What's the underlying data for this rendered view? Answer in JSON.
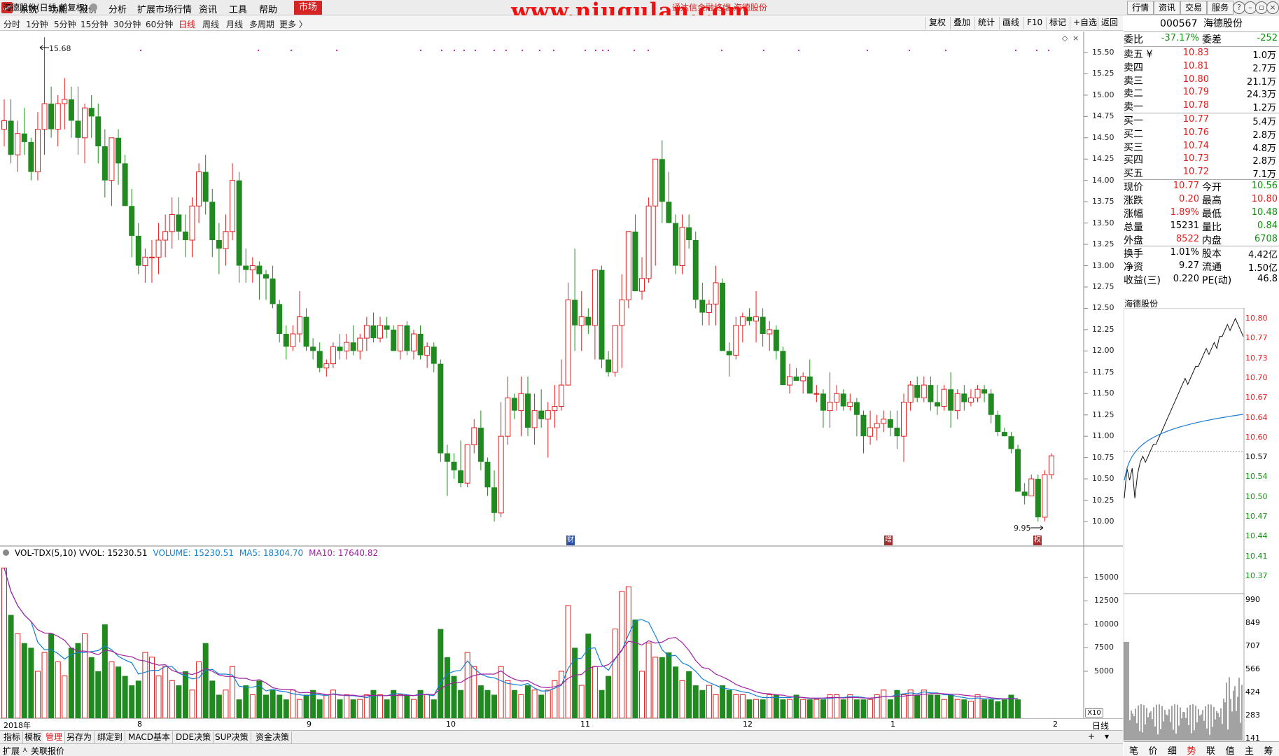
{
  "menu": {
    "items": [
      "系统",
      "功能",
      "报价",
      "分析",
      "扩展市场行情",
      "资讯",
      "工具",
      "帮助"
    ],
    "market": "市场",
    "window_title": "通达信金融终端  海德股份",
    "watermark": "www.niugulan.com",
    "right_tabs": [
      "行情",
      "资讯",
      "交易",
      "服务"
    ]
  },
  "periods": {
    "items": [
      "分时",
      "1分钟",
      "5分钟",
      "15分钟",
      "30分钟",
      "60分钟",
      "日线",
      "周线",
      "月线",
      "多周期",
      "更多 〉"
    ],
    "active": "日线"
  },
  "toolbar": {
    "items": [
      "复权",
      "叠加",
      "统计",
      "画线",
      "F10",
      "标记",
      "+自选",
      "返回"
    ]
  },
  "chart": {
    "title": "海德股份(日线,前复权)",
    "max_label": "15.68",
    "min_label": "9.95",
    "markers": [
      "财",
      "增",
      "权"
    ],
    "dates": [
      "2018年",
      "8",
      "9",
      "10",
      "11",
      "12",
      "1",
      "2"
    ],
    "period_label": "日线",
    "zoom_btn": "X10",
    "price_ticks": [
      "15.50",
      "15.25",
      "15.00",
      "14.75",
      "14.50",
      "14.25",
      "14.00",
      "13.75",
      "13.50",
      "13.25",
      "13.00",
      "12.75",
      "12.50",
      "12.25",
      "12.00",
      "11.75",
      "11.50",
      "11.25",
      "11.00",
      "10.75",
      "10.50",
      "10.25",
      "10.00"
    ],
    "vol_ticks": [
      "15000",
      "12500",
      "10000",
      "7500",
      "5000"
    ]
  },
  "chart_data": {
    "type": "candlestick",
    "title": "海德股份(日线,前复权)",
    "ylim": [
      9.9,
      15.8
    ],
    "ohlc": [
      [
        14.6,
        14.95,
        14.4,
        14.7
      ],
      [
        14.7,
        14.95,
        14.2,
        14.3
      ],
      [
        14.3,
        14.7,
        14.1,
        14.55
      ],
      [
        14.55,
        14.85,
        14.3,
        14.45
      ],
      [
        14.45,
        14.5,
        14.0,
        14.1
      ],
      [
        14.1,
        14.8,
        14.0,
        14.6
      ],
      [
        14.6,
        15.68,
        14.3,
        14.9
      ],
      [
        14.9,
        15.1,
        14.5,
        14.6
      ],
      [
        14.6,
        15.0,
        14.4,
        14.9
      ],
      [
        14.9,
        15.2,
        14.6,
        14.95
      ],
      [
        14.95,
        15.1,
        14.5,
        14.7
      ],
      [
        14.7,
        15.1,
        14.3,
        14.5
      ],
      [
        14.5,
        14.9,
        14.2,
        14.85
      ],
      [
        14.85,
        15.0,
        14.5,
        14.75
      ],
      [
        14.75,
        14.9,
        14.2,
        14.4
      ],
      [
        14.4,
        14.6,
        13.8,
        14.0
      ],
      [
        14.0,
        14.5,
        13.7,
        14.5
      ],
      [
        14.5,
        14.6,
        13.95,
        14.2
      ],
      [
        14.2,
        14.3,
        13.7,
        13.7
      ],
      [
        13.7,
        13.9,
        13.1,
        13.35
      ],
      [
        13.35,
        13.5,
        12.9,
        13.0
      ],
      [
        13.0,
        13.2,
        12.8,
        13.1
      ],
      [
        13.1,
        13.3,
        12.8,
        13.1
      ],
      [
        13.1,
        13.5,
        12.9,
        13.3
      ],
      [
        13.3,
        13.6,
        13.1,
        13.4
      ],
      [
        13.4,
        13.8,
        13.2,
        13.6
      ],
      [
        13.6,
        13.8,
        13.3,
        13.4
      ],
      [
        13.4,
        13.6,
        13.1,
        13.3
      ],
      [
        13.3,
        13.8,
        13.1,
        13.7
      ],
      [
        13.7,
        14.2,
        13.5,
        14.1
      ],
      [
        14.1,
        14.3,
        13.6,
        13.75
      ],
      [
        13.75,
        13.9,
        13.1,
        13.3
      ],
      [
        13.3,
        13.5,
        12.9,
        13.2
      ],
      [
        13.2,
        13.6,
        13.0,
        13.4
      ],
      [
        13.4,
        14.2,
        13.3,
        14.0
      ],
      [
        14.0,
        14.1,
        12.8,
        13.0
      ],
      [
        13.0,
        13.2,
        12.8,
        12.95
      ],
      [
        12.95,
        13.1,
        12.8,
        13.0
      ],
      [
        13.0,
        13.05,
        12.6,
        12.9
      ],
      [
        12.9,
        12.95,
        12.6,
        12.85
      ],
      [
        12.85,
        13.0,
        12.5,
        12.55
      ],
      [
        12.55,
        12.6,
        12.1,
        12.2
      ],
      [
        12.2,
        12.3,
        11.9,
        12.05
      ],
      [
        12.05,
        12.3,
        12.0,
        12.2
      ],
      [
        12.2,
        12.7,
        12.1,
        12.4
      ],
      [
        12.4,
        12.5,
        12.0,
        12.05
      ],
      [
        12.05,
        12.15,
        11.9,
        12.0
      ],
      [
        12.0,
        12.1,
        11.75,
        11.8
      ],
      [
        11.8,
        11.9,
        11.7,
        11.85
      ],
      [
        11.85,
        12.1,
        11.8,
        12.05
      ],
      [
        12.05,
        12.2,
        11.9,
        12.0
      ],
      [
        12.0,
        12.2,
        11.9,
        12.1
      ],
      [
        12.1,
        12.3,
        11.95,
        12.0
      ],
      [
        12.0,
        12.2,
        11.9,
        12.15
      ],
      [
        12.15,
        12.4,
        12.0,
        12.3
      ],
      [
        12.3,
        12.45,
        12.1,
        12.15
      ],
      [
        12.15,
        12.4,
        12.1,
        12.3
      ],
      [
        12.3,
        12.4,
        12.15,
        12.25
      ],
      [
        12.25,
        12.3,
        12.0,
        12.0
      ],
      [
        12.0,
        12.3,
        11.9,
        12.3
      ],
      [
        12.3,
        12.35,
        11.95,
        12.0
      ],
      [
        12.0,
        12.25,
        11.9,
        12.2
      ],
      [
        12.2,
        12.3,
        11.9,
        11.95
      ],
      [
        11.95,
        12.1,
        11.8,
        12.05
      ],
      [
        12.05,
        12.1,
        11.75,
        11.85
      ],
      [
        11.85,
        11.9,
        10.7,
        10.8
      ],
      [
        10.8,
        10.9,
        10.3,
        10.7
      ],
      [
        10.7,
        10.8,
        10.5,
        10.6
      ],
      [
        10.6,
        10.95,
        10.4,
        10.45
      ],
      [
        10.45,
        10.9,
        10.4,
        10.9
      ],
      [
        10.9,
        11.2,
        10.8,
        11.1
      ],
      [
        11.1,
        11.3,
        10.6,
        10.7
      ],
      [
        10.7,
        10.75,
        10.3,
        10.4
      ],
      [
        10.4,
        10.6,
        10.0,
        10.1
      ],
      [
        10.1,
        11.4,
        10.05,
        11.0
      ],
      [
        11.0,
        11.7,
        10.9,
        11.45
      ],
      [
        11.45,
        11.5,
        11.2,
        11.3
      ],
      [
        11.3,
        11.7,
        11.0,
        11.5
      ],
      [
        11.5,
        11.7,
        11.0,
        11.1
      ],
      [
        11.1,
        11.5,
        10.9,
        11.3
      ],
      [
        11.3,
        11.55,
        11.1,
        11.2
      ],
      [
        11.2,
        11.4,
        10.75,
        11.3
      ],
      [
        11.3,
        11.6,
        11.1,
        11.35
      ],
      [
        11.35,
        11.9,
        11.3,
        11.6
      ],
      [
        11.6,
        12.8,
        11.6,
        12.6
      ],
      [
        12.6,
        13.2,
        12.0,
        12.3
      ],
      [
        12.3,
        12.7,
        12.0,
        12.4
      ],
      [
        12.4,
        12.5,
        12.2,
        12.3
      ],
      [
        12.3,
        12.9,
        11.9,
        12.95
      ],
      [
        12.95,
        13.0,
        11.8,
        11.9
      ],
      [
        11.9,
        12.0,
        11.7,
        11.75
      ],
      [
        11.75,
        12.3,
        11.7,
        12.3
      ],
      [
        12.3,
        12.9,
        11.8,
        12.6
      ],
      [
        12.6,
        13.4,
        12.5,
        13.4
      ],
      [
        13.4,
        13.6,
        12.7,
        12.7
      ],
      [
        12.7,
        13.1,
        12.6,
        12.85
      ],
      [
        12.85,
        13.8,
        12.8,
        13.7
      ],
      [
        13.7,
        14.2,
        13.0,
        14.25
      ],
      [
        14.25,
        14.47,
        13.5,
        13.75
      ],
      [
        13.75,
        14.1,
        13.5,
        13.5
      ],
      [
        13.5,
        13.6,
        12.9,
        13.0
      ],
      [
        13.0,
        13.6,
        12.9,
        13.45
      ],
      [
        13.45,
        13.6,
        13.2,
        13.3
      ],
      [
        13.3,
        13.4,
        12.5,
        12.6
      ],
      [
        12.6,
        12.8,
        12.3,
        12.45
      ],
      [
        12.45,
        12.6,
        12.3,
        12.55
      ],
      [
        12.55,
        13.0,
        12.3,
        12.8
      ],
      [
        12.8,
        12.85,
        12.0,
        12.0
      ],
      [
        12.0,
        12.1,
        11.7,
        11.95
      ],
      [
        11.95,
        12.4,
        11.9,
        12.3
      ],
      [
        12.3,
        12.45,
        12.1,
        12.4
      ],
      [
        12.4,
        12.5,
        12.3,
        12.35
      ],
      [
        12.35,
        12.7,
        12.1,
        12.4
      ],
      [
        12.4,
        12.5,
        12.05,
        12.2
      ],
      [
        12.2,
        12.35,
        12.0,
        12.25
      ],
      [
        12.25,
        12.3,
        11.9,
        12.0
      ],
      [
        12.0,
        12.05,
        11.6,
        11.6
      ],
      [
        11.6,
        11.85,
        11.5,
        11.7
      ],
      [
        11.7,
        11.8,
        11.65,
        11.65
      ],
      [
        11.65,
        11.75,
        11.5,
        11.7
      ],
      [
        11.7,
        11.9,
        11.5,
        11.5
      ],
      [
        11.5,
        11.6,
        11.4,
        11.5
      ],
      [
        11.5,
        11.55,
        11.1,
        11.3
      ],
      [
        11.3,
        11.75,
        11.1,
        11.4
      ],
      [
        11.4,
        11.6,
        11.3,
        11.5
      ],
      [
        11.5,
        11.55,
        11.3,
        11.35
      ],
      [
        11.35,
        11.5,
        11.3,
        11.4
      ],
      [
        11.4,
        11.45,
        11.0,
        11.25
      ],
      [
        11.25,
        11.3,
        10.8,
        11.0
      ],
      [
        11.0,
        11.3,
        10.9,
        11.1
      ],
      [
        11.1,
        11.25,
        10.95,
        11.15
      ],
      [
        11.15,
        11.3,
        11.05,
        11.2
      ],
      [
        11.2,
        11.3,
        11.0,
        11.1
      ],
      [
        11.1,
        11.3,
        10.85,
        11.0
      ],
      [
        11.0,
        11.5,
        10.7,
        11.4
      ],
      [
        11.4,
        11.65,
        11.3,
        11.6
      ],
      [
        11.6,
        11.7,
        11.4,
        11.45
      ],
      [
        11.45,
        11.7,
        11.4,
        11.6
      ],
      [
        11.6,
        11.7,
        11.3,
        11.4
      ],
      [
        11.4,
        11.6,
        11.25,
        11.35
      ],
      [
        11.35,
        11.6,
        11.3,
        11.55
      ],
      [
        11.55,
        11.75,
        11.1,
        11.3
      ],
      [
        11.3,
        11.55,
        11.2,
        11.5
      ],
      [
        11.5,
        11.6,
        11.3,
        11.4
      ],
      [
        11.4,
        11.55,
        11.35,
        11.45
      ],
      [
        11.45,
        11.6,
        11.4,
        11.55
      ],
      [
        11.55,
        11.6,
        11.4,
        11.5
      ],
      [
        11.5,
        11.55,
        11.15,
        11.25
      ],
      [
        11.25,
        11.3,
        11.0,
        11.05
      ],
      [
        11.05,
        11.1,
        11.0,
        11.0
      ],
      [
        11.0,
        11.05,
        10.8,
        10.85
      ],
      [
        10.85,
        10.9,
        10.4,
        10.35
      ],
      [
        10.35,
        10.45,
        10.2,
        10.3
      ],
      [
        10.3,
        10.55,
        10.3,
        10.5
      ],
      [
        10.5,
        10.55,
        10.0,
        10.05
      ],
      [
        10.05,
        10.6,
        10.0,
        10.55
      ],
      [
        10.55,
        10.8,
        10.5,
        10.77
      ]
    ],
    "volume": {
      "title": "VOL-TDX(5,10)",
      "vvol_label": "VVOL: 15230.51",
      "volume_label": "VOLUME: 15230.51",
      "ma5_label": "MA5: 18304.70",
      "ma10_label": "MA10: 17640.82",
      "ylim": [
        0,
        17000
      ],
      "values": [
        16000,
        11000,
        9000,
        8000,
        7500,
        5000,
        7000,
        9000,
        6000,
        4500,
        7500,
        8000,
        9000,
        6500,
        5000,
        10000,
        6000,
        5500,
        4500,
        3500,
        4000,
        7000,
        6500,
        4500,
        5500,
        4000,
        3500,
        5000,
        3000,
        6000,
        8000,
        4000,
        2500,
        3000,
        5500,
        2000,
        3500,
        2500,
        4000,
        2500,
        3000,
        2500,
        2000,
        3000,
        2000,
        2500,
        3000,
        2000,
        2500,
        3000,
        2000,
        2500,
        2000,
        2000,
        2500,
        3000,
        2500,
        2000,
        3000,
        2500,
        2500,
        2000,
        3000,
        2500,
        2000,
        9500,
        6500,
        4500,
        3000,
        7000,
        5500,
        3500,
        3000,
        2500,
        5500,
        4000,
        3000,
        2500,
        3500,
        3000,
        2500,
        3000,
        4000,
        5000,
        12000,
        7500,
        3500,
        9000,
        5500,
        3000,
        4500,
        9500,
        13500,
        14000,
        10500,
        5000,
        8000,
        6500,
        6500,
        7000,
        5500,
        4000,
        5000,
        3500,
        3000,
        3500,
        2500,
        3500,
        3000,
        2500,
        2500,
        2000,
        2000,
        2000,
        2500,
        2500,
        2000,
        2000,
        2500,
        2000,
        2000,
        2000,
        2000,
        2500,
        2500,
        2000,
        2500,
        2000,
        2000,
        2000,
        2500,
        3000,
        2000,
        3000,
        2500,
        3000,
        2500,
        3000,
        2500,
        2500,
        2000,
        2500,
        2000,
        2000,
        1800,
        2500,
        2000,
        2000,
        1800,
        2000,
        2500,
        2000
      ],
      "ma5_color": "#1480d0",
      "ma10_color": "#a020a0"
    }
  },
  "quote": {
    "code": "000567",
    "name": "海德股份",
    "wei_bi_label": "委比",
    "wei_bi": "-37.17%",
    "wei_cha_label": "委差",
    "wei_cha": "-252",
    "asks": [
      {
        "label": "卖五",
        "suffix": "¥",
        "price": "10.83",
        "vol": "1.0万"
      },
      {
        "label": "卖四",
        "suffix": "",
        "price": "10.81",
        "vol": "2.7万"
      },
      {
        "label": "卖三",
        "suffix": "",
        "price": "10.80",
        "vol": "21.1万"
      },
      {
        "label": "卖二",
        "suffix": "",
        "price": "10.79",
        "vol": "24.3万"
      },
      {
        "label": "卖一",
        "suffix": "",
        "price": "10.78",
        "vol": "1.2万"
      }
    ],
    "bids": [
      {
        "label": "买一",
        "price": "10.77",
        "vol": "5.4万"
      },
      {
        "label": "买二",
        "price": "10.76",
        "vol": "2.8万"
      },
      {
        "label": "买三",
        "price": "10.74",
        "vol": "4.8万"
      },
      {
        "label": "买四",
        "price": "10.73",
        "vol": "2.8万"
      },
      {
        "label": "买五",
        "price": "10.72",
        "vol": "7.1万"
      }
    ],
    "stats": [
      {
        "l1": "现价",
        "v1": "10.77",
        "c1": "red",
        "l2": "今开",
        "v2": "10.56",
        "c2": "green"
      },
      {
        "l1": "涨跌",
        "v1": "0.20",
        "c1": "red",
        "l2": "最高",
        "v2": "10.80",
        "c2": "red"
      },
      {
        "l1": "涨幅",
        "v1": "1.89%",
        "c1": "red",
        "l2": "最低",
        "v2": "10.48",
        "c2": "green"
      },
      {
        "l1": "总量",
        "v1": "15231",
        "c1": "",
        "l2": "量比",
        "v2": "0.84",
        "c2": "green"
      },
      {
        "l1": "外盘",
        "v1": "8522",
        "c1": "red",
        "l2": "内盘",
        "v2": "6708",
        "c2": "green"
      },
      {
        "l1": "换手",
        "v1": "1.01%",
        "c1": "",
        "l2": "股本",
        "v2": "4.42亿",
        "c2": ""
      },
      {
        "l1": "净资",
        "v1": "9.27",
        "c1": "",
        "l2": "流通",
        "v2": "1.50亿",
        "c2": ""
      },
      {
        "l1": "收益(三)",
        "v1": "0.220",
        "c1": "",
        "l2": "PE(动)",
        "v2": "46.8",
        "c2": ""
      }
    ]
  },
  "mini_chart": {
    "title": "海德股份",
    "price_labels": [
      "10.80",
      "10.77",
      "10.73",
      "10.70",
      "10.67",
      "10.64",
      "10.60",
      "10.57",
      "10.54",
      "10.50",
      "10.47",
      "10.44",
      "10.41",
      "10.37"
    ],
    "vol_labels": [
      "990",
      "849",
      "707",
      "566",
      "424",
      "283",
      "141"
    ],
    "tabs": [
      "笔",
      "价",
      "细",
      "势",
      "联",
      "值",
      "主",
      "筹"
    ],
    "active_tab": "势"
  },
  "bottom": {
    "tabs": [
      "指标",
      "模板",
      "管理",
      "另存为",
      "绑定到",
      "MACD基本",
      "DDE决策",
      "SUP决策",
      "资金决策"
    ],
    "active_tab": "管理",
    "status": [
      "扩展",
      "关联报价"
    ]
  },
  "colors": {
    "up": "#e02020",
    "down": "#208a20",
    "accent": "#d42424"
  }
}
